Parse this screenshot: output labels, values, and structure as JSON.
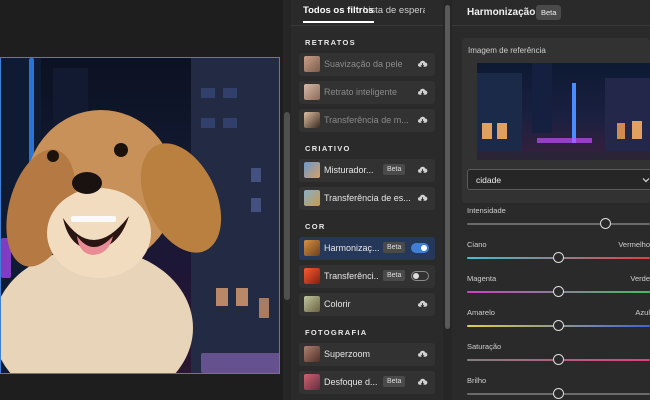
{
  "filters_panel": {
    "tabs": [
      {
        "label": "Todos os filtros",
        "active": true
      },
      {
        "label": "Lista de espera",
        "active": false
      }
    ],
    "sections": [
      {
        "title": "RETRATOS",
        "items": [
          {
            "label": "Suavização da pele",
            "dim": true,
            "action": "cloud-download-icon"
          },
          {
            "label": "Retrato inteligente",
            "dim": true,
            "action": "cloud-download-icon"
          },
          {
            "label": "Transferência de m...",
            "dim": true,
            "action": "cloud-download-icon"
          }
        ]
      },
      {
        "title": "CRIATIVO",
        "items": [
          {
            "label": "Misturador...",
            "beta": "Beta",
            "action": "cloud-download-icon"
          },
          {
            "label": "Transferência de es...",
            "action": "cloud-download-icon"
          }
        ]
      },
      {
        "title": "COR",
        "items": [
          {
            "label": "Harmonizaç...",
            "beta": "Beta",
            "toggle": "on",
            "selected": true
          },
          {
            "label": "Transferênci...",
            "beta": "Beta",
            "toggle": "off"
          },
          {
            "label": "Colorir",
            "action": "cloud-download-icon"
          }
        ]
      },
      {
        "title": "FOTOGRAFIA",
        "items": [
          {
            "label": "Superzoom",
            "action": "cloud-download-icon"
          },
          {
            "label": "Desfoque d...",
            "beta": "Beta",
            "action": "cloud-download-icon"
          }
        ]
      }
    ]
  },
  "settings": {
    "title": "Harmonização",
    "badge": "Beta",
    "reference_label": "Imagem de referência",
    "reference_select": "cidade",
    "sliders": [
      {
        "label": "Intensidade",
        "right": "",
        "value": 0.76,
        "track": "gray"
      },
      {
        "label": "Ciano",
        "right": "Vermelho",
        "value": 0.5,
        "track": "cyan-red"
      },
      {
        "label": "Magenta",
        "right": "Verde",
        "value": 0.5,
        "track": "magenta-green"
      },
      {
        "label": "Amarelo",
        "right": "Azul",
        "value": 0.5,
        "track": "yellow-blue"
      },
      {
        "label": "Saturação",
        "right": "",
        "value": 0.5,
        "track": "saturation"
      },
      {
        "label": "Brilho",
        "right": "",
        "value": 0.5,
        "track": "gray"
      }
    ]
  }
}
